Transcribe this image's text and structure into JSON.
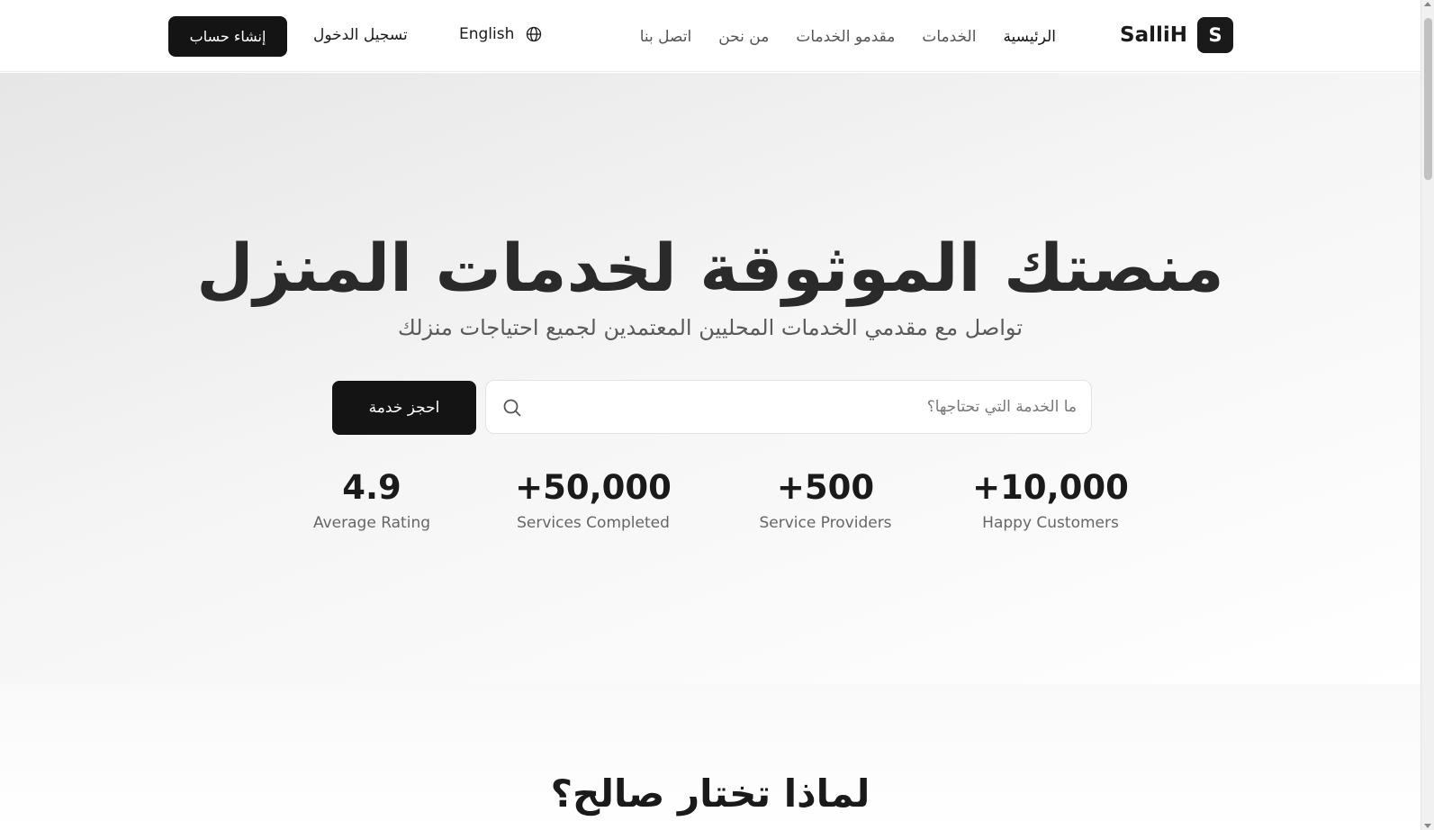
{
  "header": {
    "logo_letter": "S",
    "logo_text": "SalliH",
    "nav": [
      "الرئيسية",
      "الخدمات",
      "مقدمو الخدمات",
      "من نحن",
      "اتصل بنا"
    ],
    "language_label": "English",
    "login_label": "تسجيل الدخول",
    "signup_label": "إنشاء حساب"
  },
  "hero": {
    "title": "منصتك الموثوقة لخدمات المنزل",
    "subtitle": "تواصل مع مقدمي الخدمات المحليين المعتمدين لجميع احتياجات منزلك",
    "search_placeholder": "ما الخدمة التي تحتاجها؟",
    "book_button": "احجز خدمة",
    "stats": [
      {
        "value": "+10,000",
        "label": "Happy Customers"
      },
      {
        "value": "+500",
        "label": "Service Providers"
      },
      {
        "value": "+50,000",
        "label": "Services Completed"
      },
      {
        "value": "4.9",
        "label": "Average Rating"
      }
    ]
  },
  "why": {
    "title": "لماذا تختار صالح؟"
  },
  "colors": {
    "primary": "#141414",
    "text_muted": "#666666",
    "hero_gradient_start": "#e6e6e6",
    "hero_gradient_end": "#ffffff"
  },
  "icons": {
    "language": "globe-icon",
    "search": "search-icon"
  }
}
